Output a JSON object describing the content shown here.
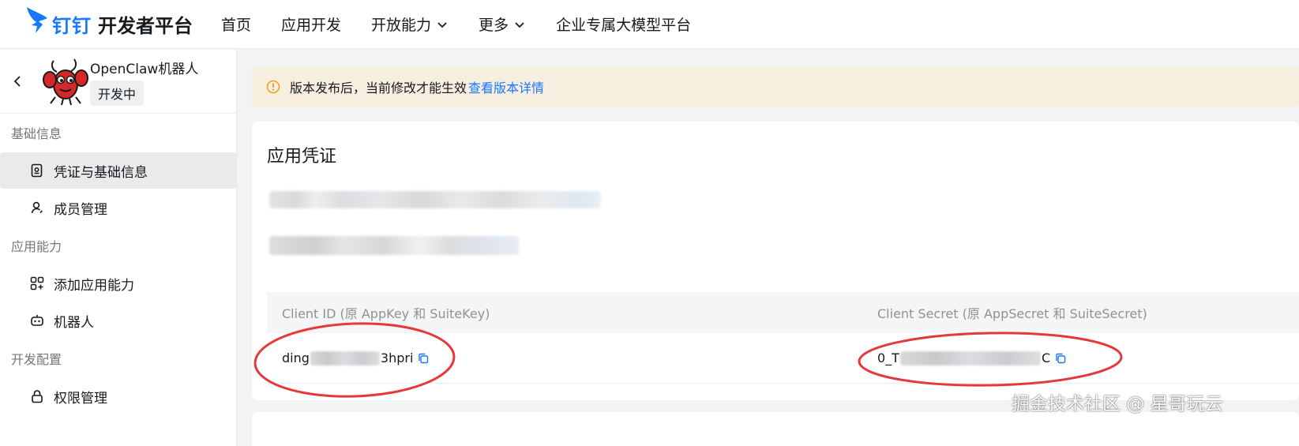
{
  "header": {
    "brand": "钉钉",
    "title": "开发者平台",
    "nav": [
      {
        "label": "首页"
      },
      {
        "label": "应用开发"
      },
      {
        "label": "开放能力"
      },
      {
        "label": "更多"
      },
      {
        "label": "企业专属大模型平台"
      }
    ]
  },
  "sidebar": {
    "app_name": "OpenClaw机器人",
    "app_status": "开发中",
    "groups": [
      {
        "title": "基础信息",
        "items": [
          {
            "label": "凭证与基础信息",
            "icon": "credential-icon",
            "active": true
          },
          {
            "label": "成员管理",
            "icon": "member-icon"
          }
        ]
      },
      {
        "title": "应用能力",
        "items": [
          {
            "label": "添加应用能力",
            "icon": "add-capability-icon"
          },
          {
            "label": "机器人",
            "icon": "robot-icon"
          }
        ]
      },
      {
        "title": "开发配置",
        "items": [
          {
            "label": "权限管理",
            "icon": "lock-icon"
          }
        ]
      }
    ]
  },
  "notice": {
    "text": "版本发布后，当前修改才能生效",
    "link": "查看版本详情"
  },
  "credentials": {
    "title": "应用凭证",
    "client_id_header": "Client ID (原 AppKey 和 SuiteKey)",
    "client_secret_header": "Client Secret (原 AppSecret 和 SuiteSecret)",
    "client_id_prefix": "ding",
    "client_id_suffix": "3hpri",
    "client_secret_prefix": "0_T",
    "client_secret_suffix": "C"
  },
  "watermark": "掘金技术社区 @ 星哥玩云",
  "colors": {
    "accent": "#1677ff",
    "notice_bg": "#f6eedf",
    "annotation": "#e5383b"
  }
}
